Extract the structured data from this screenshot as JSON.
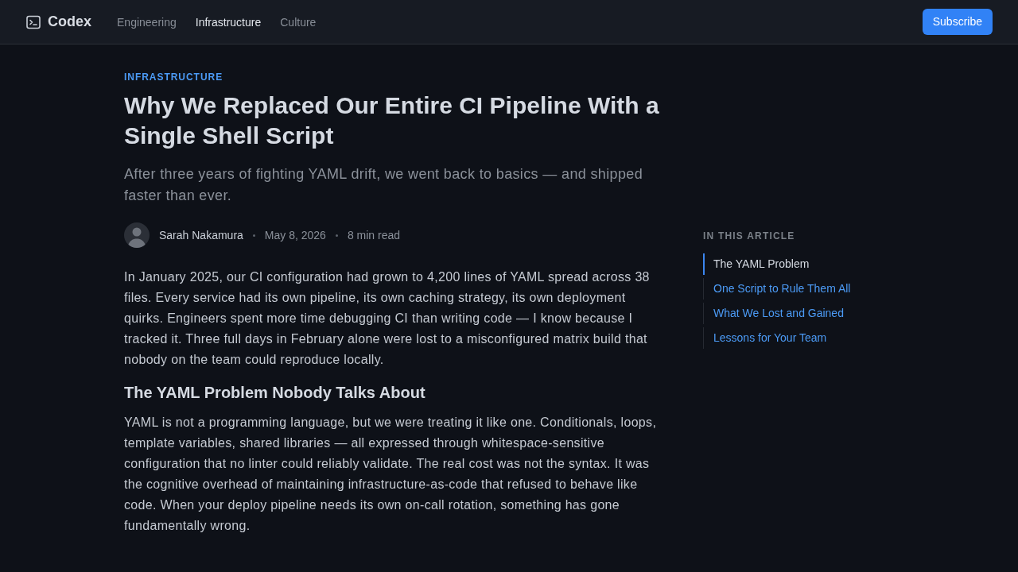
{
  "header": {
    "logo": {
      "name": "Codex"
    },
    "nav": [
      {
        "label": "Engineering",
        "selected": false
      },
      {
        "label": "Infrastructure",
        "selected": true
      },
      {
        "label": "Culture",
        "selected": false
      }
    ],
    "subscribe_button": "Subscribe"
  },
  "article": {
    "category": "INFRASTRUCTURE",
    "title": "Why We Replaced Our Entire CI Pipeline With a Single Shell Script",
    "subtitle": "After three years of fighting YAML drift, we went back to basics — and shipped faster than ever.",
    "author": {
      "name": "Sarah Nakamura"
    },
    "date": "May 8, 2026",
    "read_time": "8 min read",
    "body": [
      {
        "kind": "paragraph",
        "text": "In January 2025, our CI configuration had grown to 4,200 lines of YAML spread across 38 files. Every service had its own pipeline, its own caching strategy, its own deployment quirks. Engineers spent more time debugging CI than writing code — I know because I tracked it. Three full days in February alone were lost to a misconfigured matrix build that nobody on the team could reproduce locally."
      },
      {
        "kind": "heading",
        "text": "The YAML Problem Nobody Talks About"
      },
      {
        "kind": "paragraph",
        "text": "YAML is not a programming language, but we were treating it like one. Conditionals, loops, template variables, shared libraries — all expressed through whitespace-sensitive configuration that no linter could reliably validate. The real cost was not the syntax. It was the cognitive overhead of maintaining infrastructure-as-code that refused to behave like code. When your deploy pipeline needs its own on-call rotation, something has gone fundamentally wrong."
      }
    ]
  },
  "toc": {
    "heading": "IN THIS ARTICLE",
    "items": [
      {
        "label": "The YAML Problem",
        "selected": true
      },
      {
        "label": "One Script to Rule Them All",
        "selected": false
      },
      {
        "label": "What We Lost and Gained",
        "selected": false
      },
      {
        "label": "Lessons for Your Team",
        "selected": false
      }
    ]
  }
}
